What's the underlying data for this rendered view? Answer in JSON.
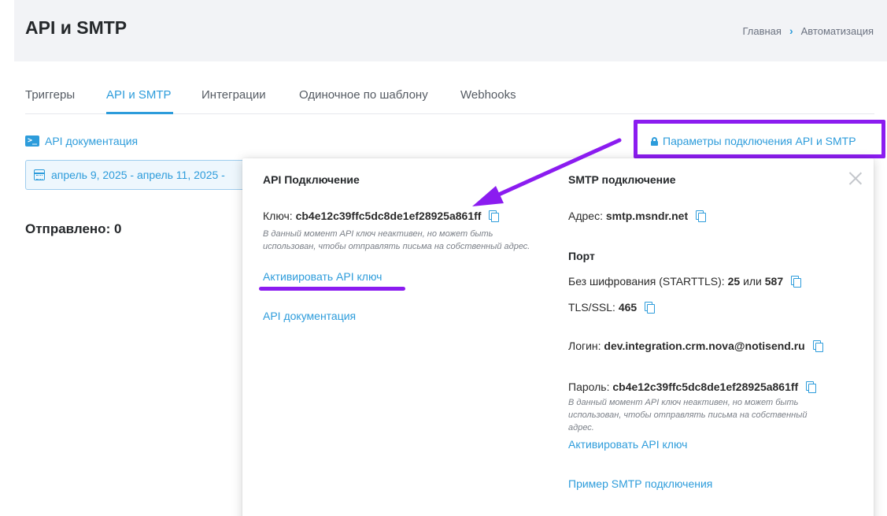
{
  "header": {
    "title": "API и SMTP",
    "breadcrumb": {
      "home": "Главная",
      "separator": "›",
      "current": "Автоматизация"
    }
  },
  "tabs": [
    {
      "label": "Триггеры",
      "active": false
    },
    {
      "label": "API и SMTP",
      "active": true
    },
    {
      "label": "Интеграции",
      "active": false
    },
    {
      "label": "Одиночное по шаблону",
      "active": false
    },
    {
      "label": "Webhooks",
      "active": false
    }
  ],
  "toolbar": {
    "api_doc_link": "API документация",
    "connection_params_link": "Параметры подключения API и SMTP",
    "date_range": "апрель 9, 2025 - апрель 11, 2025 -"
  },
  "stats": {
    "sent_label": "Отправлено: 0"
  },
  "popup": {
    "api": {
      "title": "API Подключение",
      "key_label": "Ключ:",
      "key_value": "cb4e12c39ffc5dc8de1ef28925a861ff",
      "note": "В данный момент API ключ неактивен, но может быть использован, чтобы отправлять письма на собственный адрес.",
      "activate_link": "Активировать API ключ",
      "doc_link": "API документация"
    },
    "smtp": {
      "title": "SMTP подключение",
      "address_label": "Адрес:",
      "address_value": "smtp.msndr.net",
      "port_title": "Порт",
      "plain_label": "Без шифрования (STARTTLS):",
      "plain_port_1": "25",
      "plain_or": "или",
      "plain_port_2": "587",
      "tls_label": "TLS/SSL:",
      "tls_port": "465",
      "login_label": "Логин:",
      "login_value": "dev.integration.crm.nova@notisend.ru",
      "password_label": "Пароль:",
      "password_value": "cb4e12c39ffc5dc8de1ef28925a861ff",
      "note": "В данный момент API ключ неактивен, но может быть использован, чтобы отправлять письма на собственный адрес.",
      "activate_link": "Активировать API ключ",
      "example_link": "Пример SMTP подключения"
    }
  },
  "colors": {
    "accent": "#2d9cdb",
    "annotation": "#8b1cf0",
    "header_bg": "#f2f3f6"
  }
}
